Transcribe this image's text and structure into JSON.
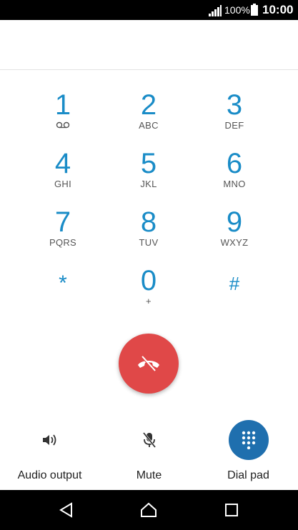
{
  "status_bar": {
    "battery_percent": "100%",
    "time": "10:00",
    "icons": [
      "signal-icon",
      "battery-icon"
    ]
  },
  "keypad": {
    "keys": [
      {
        "digit": "1",
        "sub": "",
        "sub_icon": "voicemail-icon"
      },
      {
        "digit": "2",
        "sub": "ABC"
      },
      {
        "digit": "3",
        "sub": "DEF"
      },
      {
        "digit": "4",
        "sub": "GHI"
      },
      {
        "digit": "5",
        "sub": "JKL"
      },
      {
        "digit": "6",
        "sub": "MNO"
      },
      {
        "digit": "7",
        "sub": "PQRS"
      },
      {
        "digit": "8",
        "sub": "TUV"
      },
      {
        "digit": "9",
        "sub": "WXYZ"
      },
      {
        "digit": "*",
        "sub": ""
      },
      {
        "digit": "0",
        "sub": "+"
      },
      {
        "digit": "#",
        "sub": ""
      }
    ]
  },
  "end_call": {
    "icon": "end-call-icon",
    "color": "#e04848"
  },
  "controls": {
    "audio_output": {
      "label": "Audio output",
      "icon": "speaker-icon"
    },
    "mute": {
      "label": "Mute",
      "icon": "mic-off-icon"
    },
    "dial_pad": {
      "label": "Dial pad",
      "icon": "dialpad-icon",
      "color": "#1f6fae"
    }
  },
  "nav_bar": {
    "icons": [
      "back-icon",
      "home-icon",
      "recents-icon"
    ]
  },
  "colors": {
    "accent": "#1a8cc7"
  }
}
